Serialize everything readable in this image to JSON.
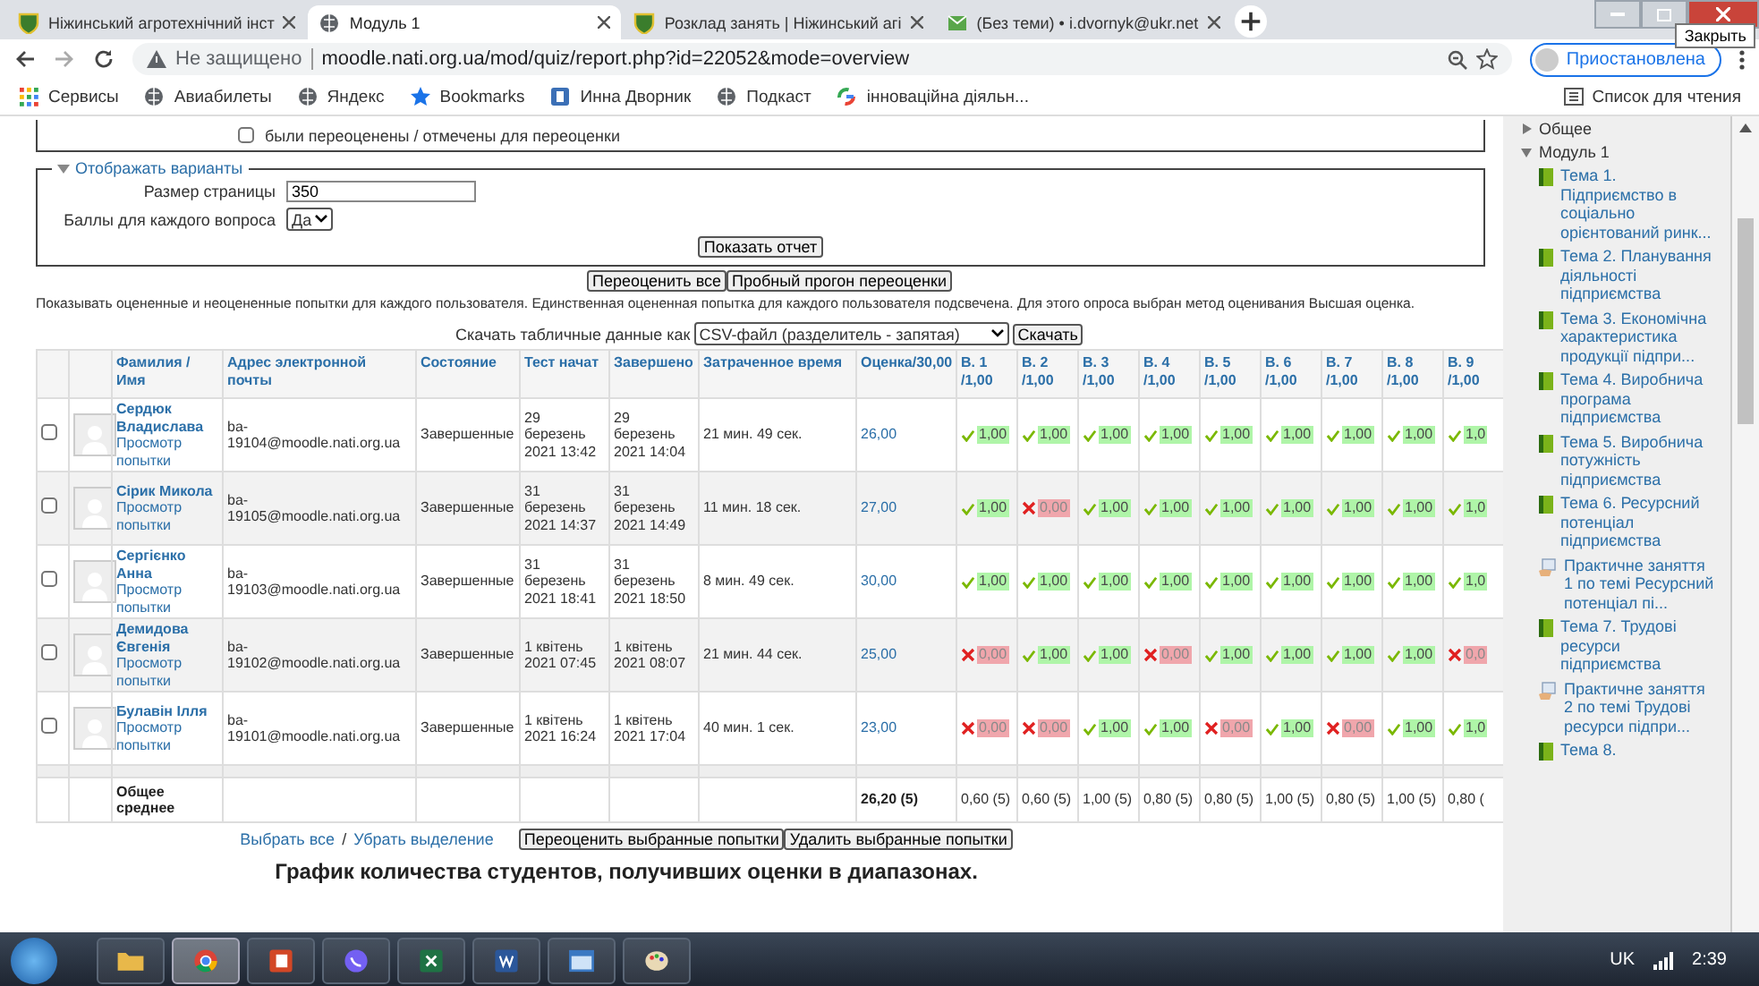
{
  "browser": {
    "tabs": [
      {
        "title": "Ніжинський агротехнічний інст",
        "kind": "crest",
        "selected": false
      },
      {
        "title": "Модуль 1",
        "kind": "globe",
        "selected": true
      },
      {
        "title": "Розклад занять | Ніжинський агі",
        "kind": "crest",
        "selected": false
      },
      {
        "title": "(Без теми) • i.dvornyk@ukr.net",
        "kind": "mail",
        "selected": false
      }
    ],
    "tooltip": "Закрыть",
    "security": "Не защищено",
    "url": "moodle.nati.org.ua/mod/quiz/report.php?id=22052&mode=overview",
    "profile": "Приостановлена",
    "bookmarks": [
      {
        "label": "Сервисы",
        "kind": "apps"
      },
      {
        "label": "Авиабилеты",
        "kind": "globe"
      },
      {
        "label": "Яндекс",
        "kind": "globe"
      },
      {
        "label": "Bookmarks",
        "kind": "star"
      },
      {
        "label": "Инна Дворник",
        "kind": "badge"
      },
      {
        "label": "Подкаст",
        "kind": "globe"
      },
      {
        "label": "інноваційна діяльн...",
        "kind": "google"
      }
    ],
    "reading_list": "Список для чтения"
  },
  "page": {
    "filter_checkbox": {
      "label": "были переоценены / отмечены для переоценки",
      "checked": false
    },
    "display_options": {
      "legend": "Отображать варианты",
      "page_size_label": "Размер страницы",
      "page_size": "350",
      "marks_label": "Баллы для каждого вопроса",
      "marks_value": "Да",
      "submit": "Показать отчет"
    },
    "regrade_buttons": [
      "Переоценить все",
      "Пробный прогон переоценки"
    ],
    "info": "Показывать оцененные и неоцененные попытки для каждого пользователя. Единственная оцененная попытка для каждого пользователя подсвечена. Для этого опроса выбран метод оценивания Высшая оценка.",
    "download": {
      "label": "Скачать табличные данные как",
      "format": "CSV-файл (разделитель - запятая)",
      "button": "Скачать"
    },
    "table": {
      "columns": [
        "Фамилия / Имя",
        "Адрес электронной почты",
        "Состояние",
        "Тест начат",
        "Завершено",
        "Затраченное время",
        "Оценка/30,00"
      ],
      "questions": [
        {
          "label": "В. 1",
          "max": "/1,00"
        },
        {
          "label": "В. 2",
          "max": "/1,00"
        },
        {
          "label": "В. 3",
          "max": "/1,00"
        },
        {
          "label": "В. 4",
          "max": "/1,00"
        },
        {
          "label": "В. 5",
          "max": "/1,00"
        },
        {
          "label": "В. 6",
          "max": "/1,00"
        },
        {
          "label": "В. 7",
          "max": "/1,00"
        },
        {
          "label": "В. 8",
          "max": "/1,00"
        },
        {
          "label": "В. 9",
          "max": "/1,00"
        }
      ],
      "rows": [
        {
          "checked": false,
          "name": "Сердюк Владислава",
          "review": "Просмотр попытки",
          "email": "ba-19104@moodle.nati.org.ua",
          "state": "Завершенные",
          "started": "29 березень 2021 13:42",
          "finished": "29 березень 2021 14:04",
          "duration": "21 мин. 49 сек.",
          "grade": "26,00",
          "answers": [
            {
              "correct": true,
              "mark": "1,00"
            },
            {
              "correct": true,
              "mark": "1,00"
            },
            {
              "correct": true,
              "mark": "1,00"
            },
            {
              "correct": true,
              "mark": "1,00"
            },
            {
              "correct": true,
              "mark": "1,00"
            },
            {
              "correct": true,
              "mark": "1,00"
            },
            {
              "correct": true,
              "mark": "1,00"
            },
            {
              "correct": true,
              "mark": "1,00"
            },
            {
              "correct": true,
              "mark": "1,0"
            }
          ]
        },
        {
          "checked": false,
          "name": "Сірик Микола",
          "review": "Просмотр попытки",
          "email": "ba-19105@moodle.nati.org.ua",
          "state": "Завершенные",
          "started": "31 березень 2021 14:37",
          "finished": "31 березень 2021 14:49",
          "duration": "11 мин. 18 сек.",
          "grade": "27,00",
          "answers": [
            {
              "correct": true,
              "mark": "1,00"
            },
            {
              "correct": false,
              "mark": "0,00"
            },
            {
              "correct": true,
              "mark": "1,00"
            },
            {
              "correct": true,
              "mark": "1,00"
            },
            {
              "correct": true,
              "mark": "1,00"
            },
            {
              "correct": true,
              "mark": "1,00"
            },
            {
              "correct": true,
              "mark": "1,00"
            },
            {
              "correct": true,
              "mark": "1,00"
            },
            {
              "correct": true,
              "mark": "1,0"
            }
          ]
        },
        {
          "checked": false,
          "name": "Сергієнко Анна",
          "review": "Просмотр попытки",
          "email": "ba-19103@moodle.nati.org.ua",
          "state": "Завершенные",
          "started": "31 березень 2021 18:41",
          "finished": "31 березень 2021 18:50",
          "duration": "8 мин. 49 сек.",
          "grade": "30,00",
          "answers": [
            {
              "correct": true,
              "mark": "1,00"
            },
            {
              "correct": true,
              "mark": "1,00"
            },
            {
              "correct": true,
              "mark": "1,00"
            },
            {
              "correct": true,
              "mark": "1,00"
            },
            {
              "correct": true,
              "mark": "1,00"
            },
            {
              "correct": true,
              "mark": "1,00"
            },
            {
              "correct": true,
              "mark": "1,00"
            },
            {
              "correct": true,
              "mark": "1,00"
            },
            {
              "correct": true,
              "mark": "1,0"
            }
          ]
        },
        {
          "checked": false,
          "name": "Демидова Євгенія",
          "review": "Просмотр попытки",
          "email": "ba-19102@moodle.nati.org.ua",
          "state": "Завершенные",
          "started": "1 квітень 2021 07:45",
          "finished": "1 квітень 2021 08:07",
          "duration": "21 мин. 44 сек.",
          "grade": "25,00",
          "answers": [
            {
              "correct": false,
              "mark": "0,00"
            },
            {
              "correct": true,
              "mark": "1,00"
            },
            {
              "correct": true,
              "mark": "1,00"
            },
            {
              "correct": false,
              "mark": "0,00"
            },
            {
              "correct": true,
              "mark": "1,00"
            },
            {
              "correct": true,
              "mark": "1,00"
            },
            {
              "correct": true,
              "mark": "1,00"
            },
            {
              "correct": true,
              "mark": "1,00"
            },
            {
              "correct": false,
              "mark": "0,0"
            }
          ]
        },
        {
          "checked": false,
          "name": "Булавін Ілля",
          "review": "Просмотр попытки",
          "email": "ba-19101@moodle.nati.org.ua",
          "state": "Завершенные",
          "started": "1 квітень 2021 16:24",
          "finished": "1 квітень 2021 17:04",
          "duration": "40 мин. 1 сек.",
          "grade": "23,00",
          "answers": [
            {
              "correct": false,
              "mark": "0,00"
            },
            {
              "correct": false,
              "mark": "0,00"
            },
            {
              "correct": true,
              "mark": "1,00"
            },
            {
              "correct": true,
              "mark": "1,00"
            },
            {
              "correct": false,
              "mark": "0,00"
            },
            {
              "correct": true,
              "mark": "1,00"
            },
            {
              "correct": false,
              "mark": "0,00"
            },
            {
              "correct": true,
              "mark": "1,00"
            },
            {
              "correct": true,
              "mark": "1,0"
            }
          ]
        }
      ],
      "footer": {
        "label": "Общее среднее",
        "grade": "26,20 (5)",
        "averages": [
          "0,60 (5)",
          "0,60 (5)",
          "1,00 (5)",
          "0,80 (5)",
          "0,80 (5)",
          "1,00 (5)",
          "0,80 (5)",
          "1,00 (5)",
          "0,80 ("
        ]
      }
    },
    "selection_links": [
      "Выбрать все",
      "Убрать выделение"
    ],
    "selection_separator": "/",
    "bulk_buttons": [
      "Переоценить выбранные попытки",
      "Удалить выбранные попытки"
    ],
    "chart_heading": "График количества студентов, получивших оценки в диапазонах."
  },
  "sidebar": {
    "items": [
      {
        "label": "Общее",
        "kind": "section",
        "expanded": false
      },
      {
        "label": "Модуль 1",
        "kind": "section",
        "expanded": true,
        "children": [
          {
            "label": "Тема 1. Підприємство в соціально орієнтований ринк...",
            "kind": "book"
          },
          {
            "label": "Тема 2. Планування діяльності підприємства",
            "kind": "book"
          },
          {
            "label": "Тема 3. Економічна характеристика продукції підпри...",
            "kind": "book"
          },
          {
            "label": "Тема 4. Виробнича програма підприємства",
            "kind": "book"
          },
          {
            "label": "Тема 5. Виробнича потужність підприємства",
            "kind": "book"
          },
          {
            "label": "Тема 6. Ресурсний потенціал підприємства",
            "kind": "book"
          },
          {
            "label": "Практичне заняття 1 по темі Ресурсний потенціал пі...",
            "kind": "assignment"
          },
          {
            "label": "Тема 7. Трудові ресурси підприємства",
            "kind": "book"
          },
          {
            "label": "Практичне заняття 2 по темі Трудові ресурси підпри...",
            "kind": "assignment"
          },
          {
            "label": "Тема 8.",
            "kind": "book"
          }
        ]
      }
    ]
  },
  "taskbar": {
    "apps": [
      {
        "kind": "folder",
        "selected": false
      },
      {
        "kind": "chrome",
        "selected": true
      },
      {
        "kind": "slides",
        "selected": false
      },
      {
        "kind": "messenger",
        "selected": false
      },
      {
        "kind": "sheet",
        "selected": false
      },
      {
        "kind": "doc",
        "selected": false
      },
      {
        "kind": "window",
        "selected": false
      },
      {
        "kind": "paint",
        "selected": false
      }
    ],
    "language": "UK",
    "time": "2:39"
  }
}
